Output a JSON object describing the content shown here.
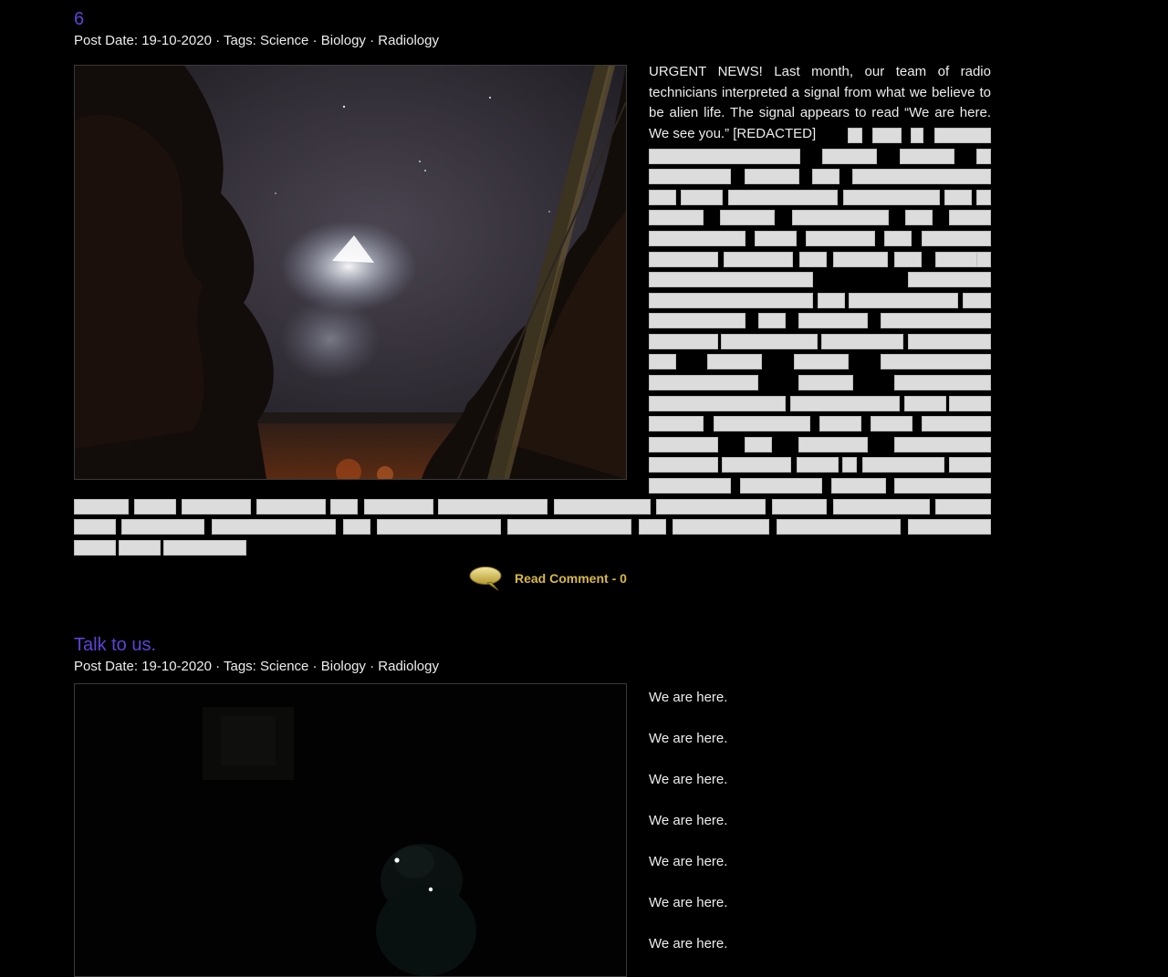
{
  "posts": [
    {
      "title": "6",
      "meta": {
        "date_prefix": "Post Date: 19-10-2020 · Tags: ",
        "tags": [
          "Science",
          "Biology",
          "Radiology"
        ],
        "separator": " · "
      },
      "body_text": "URGENT NEWS! Last month, our team of radio technicians interpreted a signal from what we believe to be alien life. The signal appears to read “We are here. We see you.” [REDACTED]",
      "comment_link": "Read Comment - 0"
    },
    {
      "title": "Talk to us.",
      "meta": {
        "date_prefix": "Post Date: 19-10-2020 · Tags: ",
        "tags": [
          "Science",
          "Biology",
          "Radiology"
        ],
        "separator": " · "
      },
      "lines": [
        "We are here.",
        "We are here.",
        "We are here.",
        "We are here.",
        "We are here.",
        "We are here.",
        "We are here."
      ]
    }
  ],
  "colors": {
    "background": "#000000",
    "title": "#5b44d6",
    "text": "#ededed",
    "redaction": "#dcdcdc",
    "comment_link": "#d8b84a"
  },
  "icons": {
    "comment": "speech-bubble-icon"
  }
}
